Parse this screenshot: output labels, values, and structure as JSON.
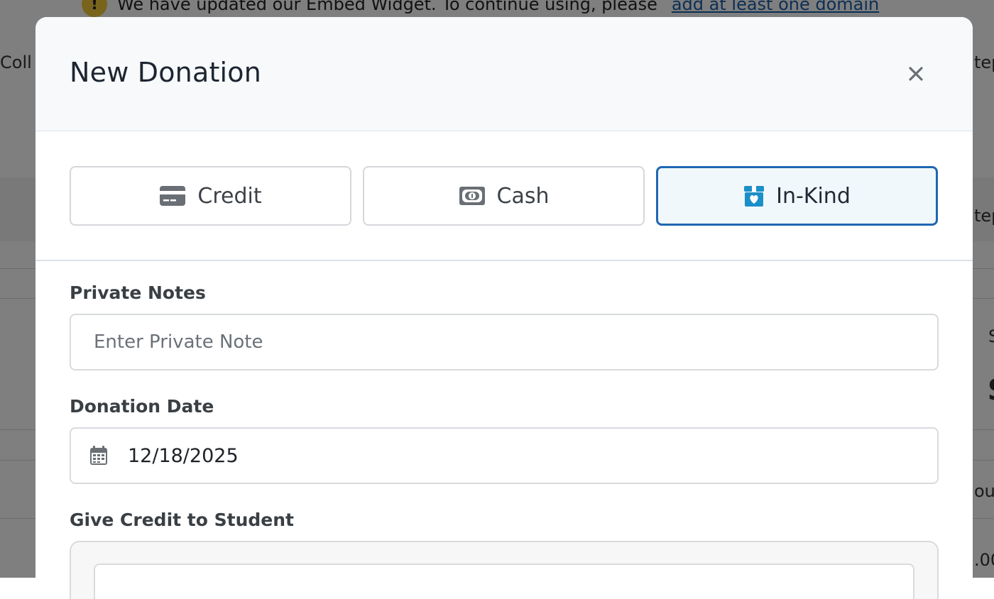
{
  "background": {
    "banner_text": "We have updated our Embed Widget. To continue using, please",
    "banner_link": "add at least one domain",
    "left_fragment": "Coll",
    "right_fragments": [
      "tep",
      "tep",
      "S",
      "$",
      "ou",
      ".00"
    ]
  },
  "modal": {
    "title": "New Donation",
    "close_icon": "close-icon",
    "donation_types": [
      {
        "label": "Credit",
        "icon": "credit-card-icon",
        "active": false
      },
      {
        "label": "Cash",
        "icon": "money-bill-icon",
        "active": false
      },
      {
        "label": "In-Kind",
        "icon": "gift-box-heart-icon",
        "active": true
      }
    ],
    "private_notes": {
      "label": "Private Notes",
      "placeholder": "Enter Private Note",
      "value": ""
    },
    "donation_date": {
      "label": "Donation Date",
      "value": "12/18/2025",
      "icon": "calendar-icon"
    },
    "give_credit": {
      "label": "Give Credit to Student"
    }
  },
  "colors": {
    "accent": "#1f67b3",
    "active_bg": "#f1f8fb",
    "inkind_icon": "#1b8fc9",
    "icon_gray": "#6a6f75"
  }
}
